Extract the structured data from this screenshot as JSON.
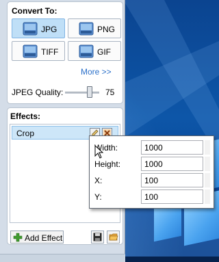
{
  "convert": {
    "title": "Convert To:",
    "formats": [
      {
        "label": "JPG",
        "icon": "jpg-file-icon",
        "selected": true
      },
      {
        "label": "PNG",
        "icon": "png-file-icon",
        "selected": false
      },
      {
        "label": "TIFF",
        "icon": "tiff-file-icon",
        "selected": false
      },
      {
        "label": "GIF",
        "icon": "gif-file-icon",
        "selected": false
      }
    ],
    "more_link": "More >>",
    "quality_label": "JPEG Quality:",
    "quality_value": "75"
  },
  "effects": {
    "title": "Effects:",
    "items": [
      {
        "name": "Crop"
      }
    ],
    "add_label": "Add Effect"
  },
  "crop_popup": {
    "fields": [
      {
        "label": "Width:",
        "value": "1000"
      },
      {
        "label": "Height:",
        "value": "1000"
      },
      {
        "label": "X:",
        "value": "100"
      },
      {
        "label": "Y:",
        "value": "100"
      }
    ]
  },
  "colors": {
    "selected_button": "#bfdff7",
    "more_link": "#2a6fc9",
    "desktop": "#0d56a8"
  }
}
